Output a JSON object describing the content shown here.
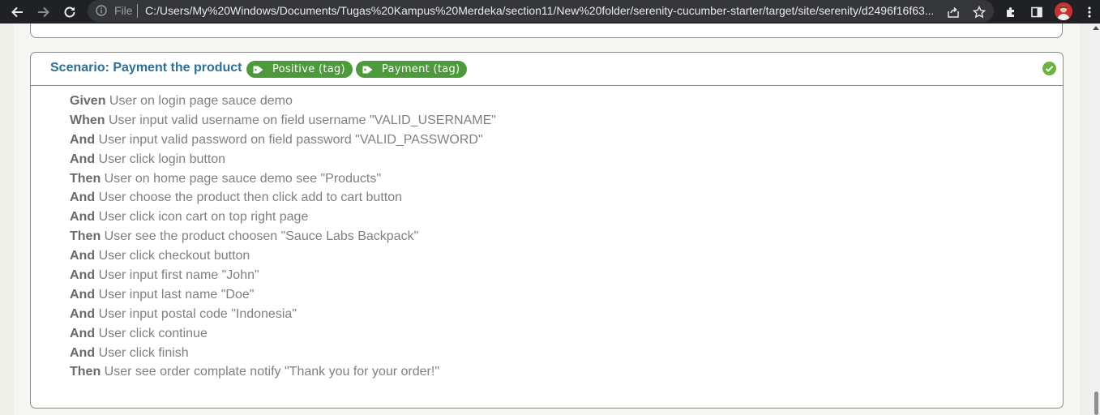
{
  "browser": {
    "file_label": "File",
    "url": "C:/Users/My%20Windows/Documents/Tugas%20Kampus%20Merdeka/section11/New%20folder/serenity-cucumber-starter/target/site/serenity/d2496f16f63..."
  },
  "scenario": {
    "title": "Scenario: Payment the product",
    "tags": [
      {
        "label": "Positive (tag)"
      },
      {
        "label": "Payment (tag)"
      }
    ],
    "status_color": "#6ab43e",
    "steps": [
      {
        "keyword": "Given",
        "text": "User on login page sauce demo"
      },
      {
        "keyword": "When",
        "text": "User input valid username on field username \"VALID_USERNAME\""
      },
      {
        "keyword": "And",
        "text": "User input valid password on field password \"VALID_PASSWORD\""
      },
      {
        "keyword": "And",
        "text": "User click login button"
      },
      {
        "keyword": "Then",
        "text": "User on home page sauce demo see \"Products\""
      },
      {
        "keyword": "And",
        "text": "User choose the product then click add to cart button"
      },
      {
        "keyword": "And",
        "text": "User click icon cart on top right page"
      },
      {
        "keyword": "Then",
        "text": "User see the product choosen \"Sauce Labs Backpack\""
      },
      {
        "keyword": "And",
        "text": "User click checkout button"
      },
      {
        "keyword": "And",
        "text": "User input first name \"John\""
      },
      {
        "keyword": "And",
        "text": "User input last name \"Doe\""
      },
      {
        "keyword": "And",
        "text": "User input postal code \"Indonesia\""
      },
      {
        "keyword": "And",
        "text": "User click continue"
      },
      {
        "keyword": "And",
        "text": "User click finish"
      },
      {
        "keyword": "Then",
        "text": "User see order complate notify \"Thank you for your order!\""
      }
    ]
  }
}
